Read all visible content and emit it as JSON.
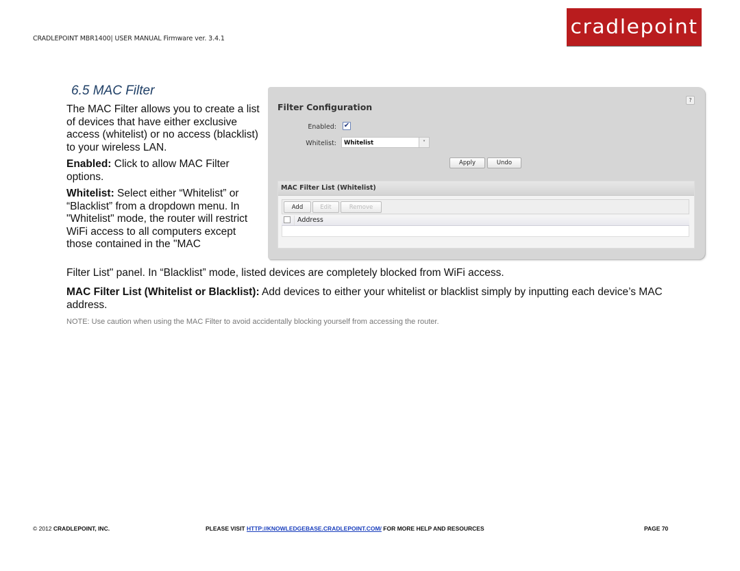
{
  "header": {
    "manual_title": "CRADLEPOINT MBR1400| USER MANUAL Firmware ver. 3.4.1",
    "logo_text": "cradlepoint",
    "brand_color": "#b91c1e"
  },
  "section": {
    "number_title": "6.5  MAC Filter"
  },
  "body": {
    "intro": "The MAC Filter allows you to create a list of devices that have either exclusive access (whitelist) or no access (blacklist) to your wireless LAN.",
    "enabled_term": "Enabled:",
    "enabled_desc": " Click to allow MAC Filter options.",
    "whitelist_term": "Whitelist:",
    "whitelist_desc": " Select either “Whitelist” or “Blacklist” from a dropdown menu. In \"Whitelist\" mode, the router will restrict WiFi access to all computers except those contained in the \"MAC",
    "whitelist_desc_cont": "Filter List\" panel. In “Blacklist” mode, listed devices are completely blocked from WiFi access.",
    "list_term": "MAC Filter List (Whitelist or Blacklist):",
    "list_desc": " Add devices to either your whitelist or blacklist simply by inputting each device’s MAC address.",
    "note": "NOTE: Use caution when using the MAC Filter to avoid accidentally blocking yourself from accessing the router."
  },
  "screenshot": {
    "panel_title": "Filter Configuration",
    "help_label": "?",
    "enabled_label": "Enabled:",
    "enabled_checked": true,
    "checkmark": "✔",
    "whitelist_label": "Whitelist:",
    "whitelist_value": "Whitelist",
    "dropdown_arrow": "˅",
    "apply_label": "Apply",
    "undo_label": "Undo",
    "list_title": "MAC Filter List (Whitelist)",
    "add_label": "Add",
    "edit_label": "Edit",
    "remove_label": "Remove",
    "column_address": "Address",
    "rows": []
  },
  "footer": {
    "copyright_prefix": "© 2012 ",
    "company": "CRADLEPOINT, INC.",
    "visit_prefix": "PLEASE VISIT ",
    "link": "HTTP://KNOWLEDGEBASE.CRADLEPOINT.COM/",
    "visit_suffix": " FOR MORE HELP AND RESOURCES",
    "page": "PAGE 70"
  }
}
